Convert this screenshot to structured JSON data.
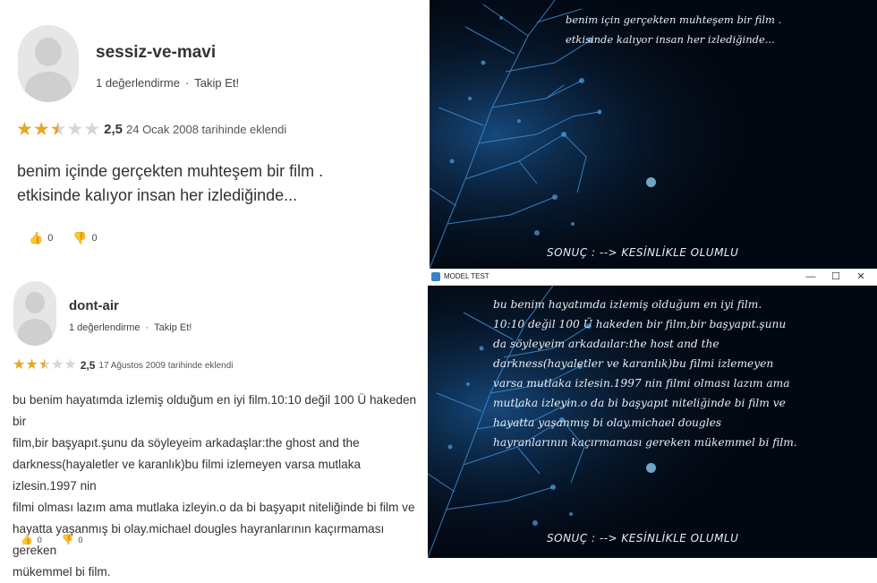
{
  "review1": {
    "username": "sessiz-ve-mavi",
    "rating_count": "1 değerlendirme",
    "follow": "Takip Et!",
    "score": "2,5",
    "stars_filled": 2.5,
    "date": "24 Ocak 2008 tarihinde eklendi",
    "text_line1": "benim içinde gerçekten muhteşem bir film .",
    "text_line2": "etkisinde kalıyor insan her izlediğinde...",
    "likes": "0",
    "dislikes": "0"
  },
  "review2": {
    "username": "dont-air",
    "rating_count": "1 değerlendirme",
    "follow": "Takip Et!",
    "score": "2,5",
    "stars_filled": 2.5,
    "date": "17 Ağustos 2009 tarihinde eklendi",
    "lines": [
      "bu benim hayatımda izlemiş olduğum en iyi film.10:10 değil 100 Ü hakeden bir",
      "film,bir başyapıt.şunu da söyleyeim arkadaşlar:the ghost and the",
      "darkness(hayaletler ve karanlık)bu filmi izlemeyen varsa mutlaka izlesin.1997 nin",
      "filmi olması lazım ama mutlaka izleyin.o da bi başyapıt niteliğinde bi film ve",
      "hayatta yaşanmış bi olay.michael dougles hayranlarının kaçırmaması gereken",
      "mükemmel bi film."
    ],
    "likes": "0",
    "dislikes": "0"
  },
  "app1": {
    "lines": [
      "benim için gerçekten muhteşem bir film .",
      "etkisinde kalıyor insan her izlediğinde..."
    ],
    "result": "SONUÇ :  --> KESİNLİKLE OLUMLU"
  },
  "app2": {
    "window_title": "MODEL TEST",
    "minimize": "—",
    "maximize": "☐",
    "close": "✕",
    "lines": [
      "bu benim hayatımda izlemiş olduğum en iyi film.",
      "10:10 değil 100 Ü hakeden bir film,bir başyapıt.şunu",
      "da söyleyeim arkadaılar:the host and the",
      "darkness(hayaletler ve karanlık)bu filmi izlemeyen",
      "varsa mutlaka izlesin.1997 nin filmi olması lazım ama",
      "mutlaka izleyin.o da bi başyapıt niteliğinde bi film ve",
      "hayatta yaşanmış bi olay.michael dougles",
      "hayranlarının kaçırmaması gereken mükemmel bi film."
    ],
    "result": "SONUÇ :  --> KESİNLİKLE OLUMLU"
  },
  "colors": {
    "star_on": "#e5a823",
    "star_off": "#d6d6d6",
    "dark_bg": "#020812",
    "tree_blue": "#3f8fd6"
  }
}
